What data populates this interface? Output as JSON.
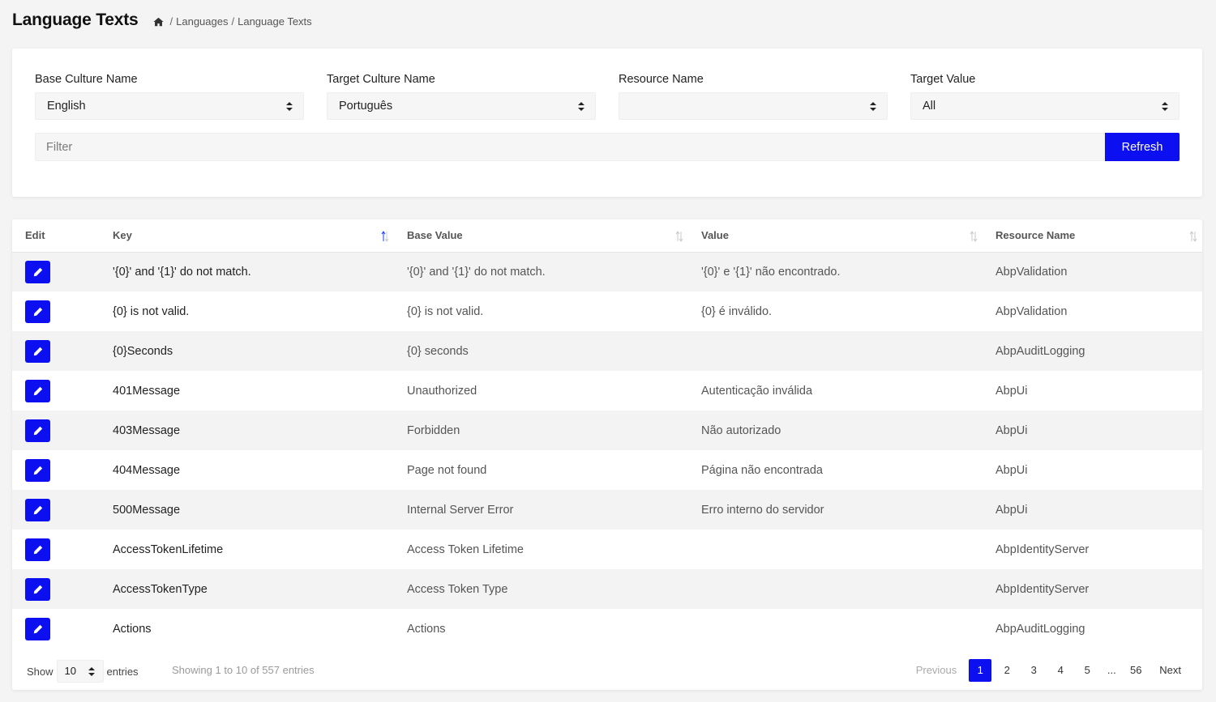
{
  "header": {
    "title": "Language Texts",
    "breadcrumb": [
      "Languages",
      "Language Texts"
    ],
    "home_icon": "home-icon"
  },
  "filters": {
    "base_culture": {
      "label": "Base Culture Name",
      "value": "English"
    },
    "target_culture": {
      "label": "Target Culture Name",
      "value": "Português"
    },
    "resource_name": {
      "label": "Resource Name",
      "value": ""
    },
    "target_value": {
      "label": "Target Value",
      "value": "All"
    },
    "filter_placeholder": "Filter",
    "refresh_label": "Refresh"
  },
  "table": {
    "columns": [
      "Edit",
      "Key",
      "Base Value",
      "Value",
      "Resource Name"
    ],
    "sorted_column": "Key",
    "rows": [
      {
        "key": "'{0}' and '{1}' do not match.",
        "base": "'{0}' and '{1}' do not match.",
        "value": "'{0}' e '{1}' não encontrado.",
        "resource": "AbpValidation"
      },
      {
        "key": "{0} is not valid.",
        "base": "{0} is not valid.",
        "value": "{0} é inválido.",
        "resource": "AbpValidation"
      },
      {
        "key": "{0}Seconds",
        "base": "{0} seconds",
        "value": "",
        "resource": "AbpAuditLogging"
      },
      {
        "key": "401Message",
        "base": "Unauthorized",
        "value": "Autenticação inválida",
        "resource": "AbpUi"
      },
      {
        "key": "403Message",
        "base": "Forbidden",
        "value": "Não autorizado",
        "resource": "AbpUi"
      },
      {
        "key": "404Message",
        "base": "Page not found",
        "value": "Página não encontrada",
        "resource": "AbpUi"
      },
      {
        "key": "500Message",
        "base": "Internal Server Error",
        "value": "Erro interno do servidor",
        "resource": "AbpUi"
      },
      {
        "key": "AccessTokenLifetime",
        "base": "Access Token Lifetime",
        "value": "",
        "resource": "AbpIdentityServer"
      },
      {
        "key": "AccessTokenType",
        "base": "Access Token Type",
        "value": "",
        "resource": "AbpIdentityServer"
      },
      {
        "key": "Actions",
        "base": "Actions",
        "value": "",
        "resource": "AbpAuditLogging"
      }
    ]
  },
  "footer": {
    "show_label": "Show",
    "page_size": "10",
    "entries_label": "entries",
    "info": "Showing 1 to 10 of 557 entries",
    "previous": "Previous",
    "pages": [
      "1",
      "2",
      "3",
      "4",
      "5"
    ],
    "ellipsis": "...",
    "last_page": "56",
    "next": "Next",
    "active_page": "1"
  },
  "colors": {
    "primary": "#0c0ff0",
    "row_stripe": "#f3f3f4",
    "background": "#f4f4f5"
  }
}
